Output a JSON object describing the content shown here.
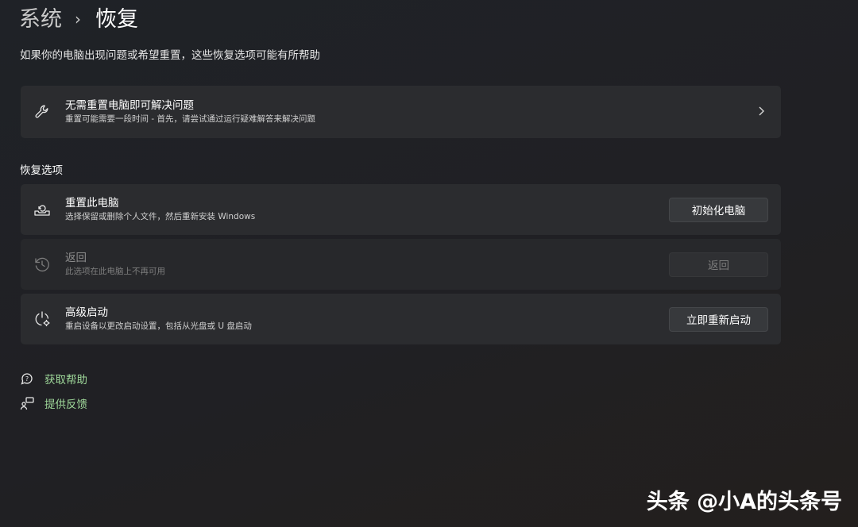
{
  "breadcrumb": {
    "parent": "系统",
    "separator": "›",
    "current": "恢复"
  },
  "subtitle": "如果你的电脑出现问题或希望重置，这些恢复选项可能有所帮助",
  "troubleshoot_card": {
    "title": "无需重置电脑即可解决问题",
    "description": "重置可能需要一段时间 - 首先，请尝试通过运行疑难解答来解决问题",
    "icon": "wrench-icon"
  },
  "section_label": "恢复选项",
  "options": [
    {
      "title": "重置此电脑",
      "description": "选择保留或删除个人文件，然后重新安装 Windows",
      "button": "初始化电脑",
      "icon": "reset-pc-icon",
      "enabled": true
    },
    {
      "title": "返回",
      "description": "此选项在此电脑上不再可用",
      "button": "返回",
      "icon": "history-icon",
      "enabled": false
    },
    {
      "title": "高级启动",
      "description": "重启设备以更改启动设置，包括从光盘或 U 盘启动",
      "button": "立即重新启动",
      "icon": "advanced-startup-icon",
      "enabled": true
    }
  ],
  "links": [
    {
      "label": "获取帮助",
      "icon": "help-chat-icon"
    },
    {
      "label": "提供反馈",
      "icon": "feedback-icon"
    }
  ],
  "watermark": "头条 @小A的头条号",
  "colors": {
    "link": "#9fd89a",
    "card": "#2b2c2f",
    "background": "#202024"
  }
}
